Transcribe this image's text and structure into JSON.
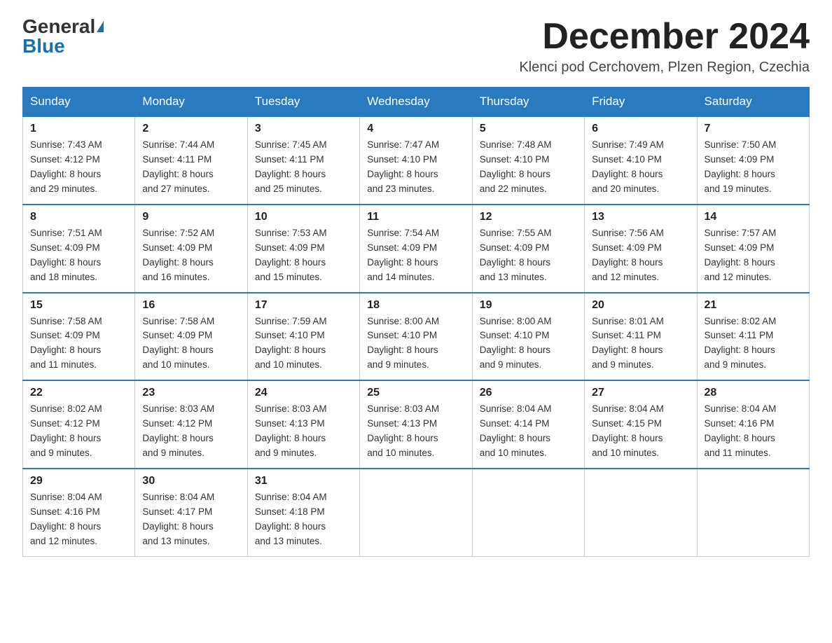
{
  "header": {
    "logo_general": "General",
    "logo_blue": "Blue",
    "month_year": "December 2024",
    "location": "Klenci pod Cerchovem, Plzen Region, Czechia"
  },
  "days_of_week": [
    "Sunday",
    "Monday",
    "Tuesday",
    "Wednesday",
    "Thursday",
    "Friday",
    "Saturday"
  ],
  "weeks": [
    [
      {
        "day": "1",
        "sunrise": "7:43 AM",
        "sunset": "4:12 PM",
        "daylight": "8 hours and 29 minutes."
      },
      {
        "day": "2",
        "sunrise": "7:44 AM",
        "sunset": "4:11 PM",
        "daylight": "8 hours and 27 minutes."
      },
      {
        "day": "3",
        "sunrise": "7:45 AM",
        "sunset": "4:11 PM",
        "daylight": "8 hours and 25 minutes."
      },
      {
        "day": "4",
        "sunrise": "7:47 AM",
        "sunset": "4:10 PM",
        "daylight": "8 hours and 23 minutes."
      },
      {
        "day": "5",
        "sunrise": "7:48 AM",
        "sunset": "4:10 PM",
        "daylight": "8 hours and 22 minutes."
      },
      {
        "day": "6",
        "sunrise": "7:49 AM",
        "sunset": "4:10 PM",
        "daylight": "8 hours and 20 minutes."
      },
      {
        "day": "7",
        "sunrise": "7:50 AM",
        "sunset": "4:09 PM",
        "daylight": "8 hours and 19 minutes."
      }
    ],
    [
      {
        "day": "8",
        "sunrise": "7:51 AM",
        "sunset": "4:09 PM",
        "daylight": "8 hours and 18 minutes."
      },
      {
        "day": "9",
        "sunrise": "7:52 AM",
        "sunset": "4:09 PM",
        "daylight": "8 hours and 16 minutes."
      },
      {
        "day": "10",
        "sunrise": "7:53 AM",
        "sunset": "4:09 PM",
        "daylight": "8 hours and 15 minutes."
      },
      {
        "day": "11",
        "sunrise": "7:54 AM",
        "sunset": "4:09 PM",
        "daylight": "8 hours and 14 minutes."
      },
      {
        "day": "12",
        "sunrise": "7:55 AM",
        "sunset": "4:09 PM",
        "daylight": "8 hours and 13 minutes."
      },
      {
        "day": "13",
        "sunrise": "7:56 AM",
        "sunset": "4:09 PM",
        "daylight": "8 hours and 12 minutes."
      },
      {
        "day": "14",
        "sunrise": "7:57 AM",
        "sunset": "4:09 PM",
        "daylight": "8 hours and 12 minutes."
      }
    ],
    [
      {
        "day": "15",
        "sunrise": "7:58 AM",
        "sunset": "4:09 PM",
        "daylight": "8 hours and 11 minutes."
      },
      {
        "day": "16",
        "sunrise": "7:58 AM",
        "sunset": "4:09 PM",
        "daylight": "8 hours and 10 minutes."
      },
      {
        "day": "17",
        "sunrise": "7:59 AM",
        "sunset": "4:10 PM",
        "daylight": "8 hours and 10 minutes."
      },
      {
        "day": "18",
        "sunrise": "8:00 AM",
        "sunset": "4:10 PM",
        "daylight": "8 hours and 9 minutes."
      },
      {
        "day": "19",
        "sunrise": "8:00 AM",
        "sunset": "4:10 PM",
        "daylight": "8 hours and 9 minutes."
      },
      {
        "day": "20",
        "sunrise": "8:01 AM",
        "sunset": "4:11 PM",
        "daylight": "8 hours and 9 minutes."
      },
      {
        "day": "21",
        "sunrise": "8:02 AM",
        "sunset": "4:11 PM",
        "daylight": "8 hours and 9 minutes."
      }
    ],
    [
      {
        "day": "22",
        "sunrise": "8:02 AM",
        "sunset": "4:12 PM",
        "daylight": "8 hours and 9 minutes."
      },
      {
        "day": "23",
        "sunrise": "8:03 AM",
        "sunset": "4:12 PM",
        "daylight": "8 hours and 9 minutes."
      },
      {
        "day": "24",
        "sunrise": "8:03 AM",
        "sunset": "4:13 PM",
        "daylight": "8 hours and 9 minutes."
      },
      {
        "day": "25",
        "sunrise": "8:03 AM",
        "sunset": "4:13 PM",
        "daylight": "8 hours and 10 minutes."
      },
      {
        "day": "26",
        "sunrise": "8:04 AM",
        "sunset": "4:14 PM",
        "daylight": "8 hours and 10 minutes."
      },
      {
        "day": "27",
        "sunrise": "8:04 AM",
        "sunset": "4:15 PM",
        "daylight": "8 hours and 10 minutes."
      },
      {
        "day": "28",
        "sunrise": "8:04 AM",
        "sunset": "4:16 PM",
        "daylight": "8 hours and 11 minutes."
      }
    ],
    [
      {
        "day": "29",
        "sunrise": "8:04 AM",
        "sunset": "4:16 PM",
        "daylight": "8 hours and 12 minutes."
      },
      {
        "day": "30",
        "sunrise": "8:04 AM",
        "sunset": "4:17 PM",
        "daylight": "8 hours and 13 minutes."
      },
      {
        "day": "31",
        "sunrise": "8:04 AM",
        "sunset": "4:18 PM",
        "daylight": "8 hours and 13 minutes."
      },
      null,
      null,
      null,
      null
    ]
  ]
}
